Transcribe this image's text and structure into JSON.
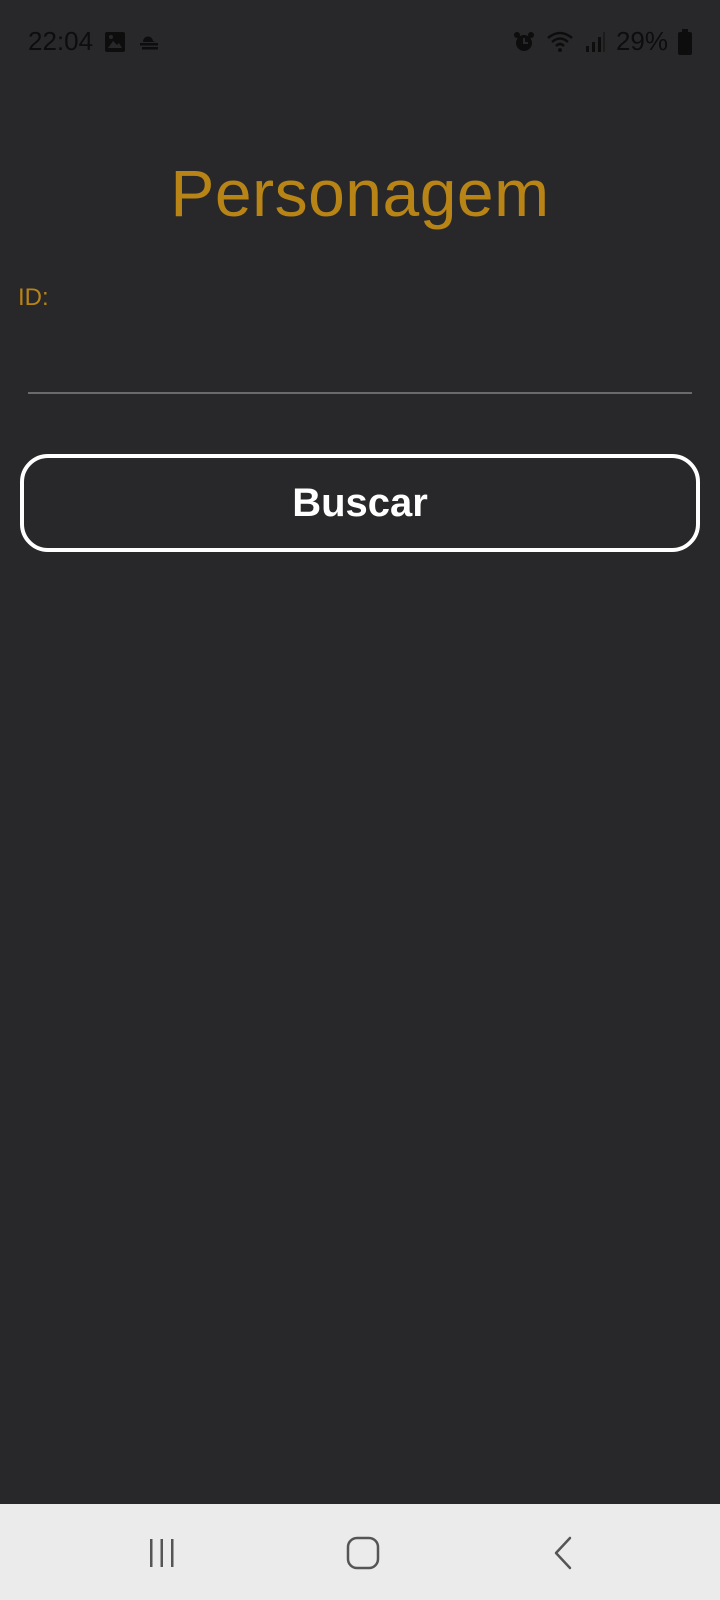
{
  "status_bar": {
    "time": "22:04",
    "battery_percent": "29%",
    "left_icons": [
      "gallery-icon",
      "weather-fog-icon"
    ],
    "right_icons": [
      "alarm-icon",
      "wifi-icon",
      "signal-icon",
      "battery-icon"
    ]
  },
  "page": {
    "title": "Personagem",
    "id_label": "ID:",
    "id_input_value": "",
    "search_button_label": "Buscar"
  },
  "nav_bar": {
    "buttons": [
      "recent-apps-icon",
      "home-icon",
      "back-icon"
    ]
  },
  "colors": {
    "background": "#28282a",
    "accent": "#b88416",
    "button_border": "#ffffff",
    "nav_bar": "#ebebeb"
  }
}
